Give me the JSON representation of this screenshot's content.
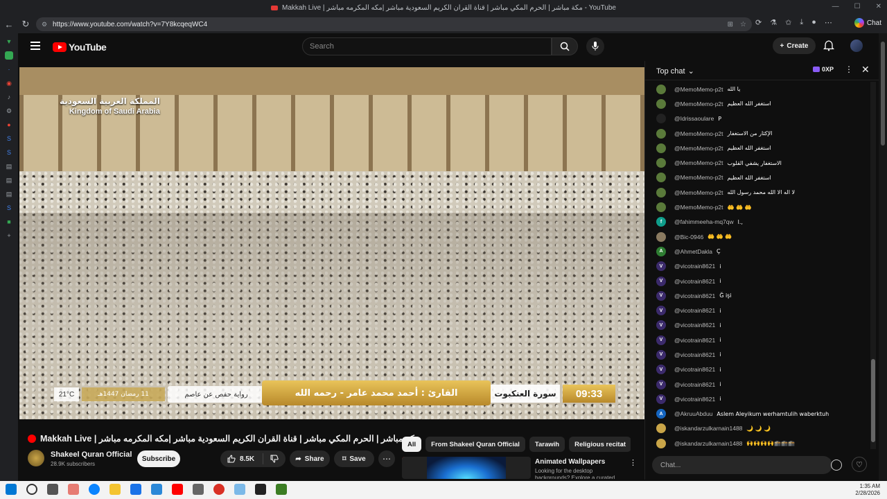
{
  "browser": {
    "tab_title": "Makkah Live | مكة مباشر | الحرم المكي مباشر | قناة القران الكريم السعودية مباشر |مكه المكرمه مباشر - YouTube",
    "url": "https://www.youtube.com/watch?v=7Y8kcqeqWC4",
    "chat_button": "Chat"
  },
  "youtube": {
    "logo_text": "YouTube",
    "search_placeholder": "Search",
    "create_label": "Create"
  },
  "video": {
    "overlay": {
      "country_ar": "المملكة العربية السعودية",
      "country_en": "Kingdom of Saudi Arabia",
      "reciter": "القارئ : أحمد محمد عامر - رحمه الله",
      "riwaya": "رواية حفص عن عاصم",
      "date": "11 رمضان 1447هـ",
      "temp": "21°C",
      "surah": "سورة العنكبوت",
      "time": "09:33"
    },
    "title": "Makkah Live | مكة مباشر | الحرم المكي مباشر | قناة القران الكريم السعودية مباشر |مكه المكرمه مباشر",
    "channel": "Shakeel Quran Official",
    "subscribers": "28.9K subscribers",
    "subscribe_label": "Subscribe",
    "likes": "8.5K",
    "share_label": "Share",
    "save_label": "Save"
  },
  "chips": [
    "All",
    "From Shakeel Quran Official",
    "Tarawih",
    "Religious recitat"
  ],
  "recommendation": {
    "title": "Animated Wallpapers",
    "desc": "Looking for the desktop backgrounds? Explore a curated"
  },
  "chat": {
    "header": "Top chat",
    "xp": "0XP",
    "input_placeholder": "Chat...",
    "messages": [
      {
        "author": "@MemoMemo-p2t",
        "text": "يا الله",
        "color": "#5a7a3a",
        "initial": ""
      },
      {
        "author": "@MemoMemo-p2t",
        "text": "استغفر الله العظيم",
        "color": "#5a7a3a",
        "initial": ""
      },
      {
        "author": "@Idrissaoulare",
        "text": "P",
        "color": "#222222",
        "initial": ""
      },
      {
        "author": "@MemoMemo-p2t",
        "text": "الإكثار من الاستغفار",
        "color": "#5a7a3a",
        "initial": ""
      },
      {
        "author": "@MemoMemo-p2t",
        "text": "استغفر الله العظيم",
        "color": "#5a7a3a",
        "initial": ""
      },
      {
        "author": "@MemoMemo-p2t",
        "text": "الاستغفار يشفي القلوب",
        "color": "#5a7a3a",
        "initial": ""
      },
      {
        "author": "@MemoMemo-p2t",
        "text": "استغفر الله العظيم",
        "color": "#5a7a3a",
        "initial": ""
      },
      {
        "author": "@MemoMemo-p2t",
        "text": "لا اله الا الله محمد رسول الله",
        "color": "#5a7a3a",
        "initial": ""
      },
      {
        "author": "@MemoMemo-p2t",
        "text": "🤲 🤲 🤲",
        "color": "#5a7a3a",
        "initial": ""
      },
      {
        "author": "@fahimmeeha-mq7qw",
        "text": "l.,",
        "color": "#0f9d8a",
        "initial": "f"
      },
      {
        "author": "@Bic-0946",
        "text": "🤲 🤲 🤲",
        "color": "#8a7a60",
        "initial": ""
      },
      {
        "author": "@AhmetDakla",
        "text": "Ç",
        "color": "#2e7d32",
        "initial": "A"
      },
      {
        "author": "@vicotrain8621",
        "text": "i",
        "color": "#3b2a6b",
        "initial": "V"
      },
      {
        "author": "@vicotrain8621",
        "text": "i",
        "color": "#3b2a6b",
        "initial": "V"
      },
      {
        "author": "@vicotrain8621",
        "text": "Ğ işi",
        "color": "#3b2a6b",
        "initial": "V"
      },
      {
        "author": "@vicotrain8621",
        "text": "i",
        "color": "#3b2a6b",
        "initial": "V"
      },
      {
        "author": "@vicotrain8621",
        "text": "i",
        "color": "#3b2a6b",
        "initial": "V"
      },
      {
        "author": "@vicotrain8621",
        "text": "i",
        "color": "#3b2a6b",
        "initial": "V"
      },
      {
        "author": "@vicotrain8621",
        "text": "i",
        "color": "#3b2a6b",
        "initial": "V"
      },
      {
        "author": "@vicotrain8621",
        "text": "i",
        "color": "#3b2a6b",
        "initial": "V"
      },
      {
        "author": "@vicotrain8621",
        "text": "i",
        "color": "#3b2a6b",
        "initial": "V"
      },
      {
        "author": "@vicotrain8621",
        "text": "i",
        "color": "#3b2a6b",
        "initial": "V"
      },
      {
        "author": "@AkruuAbduu",
        "text": "Aslem Aleyikum werhamtulih waberktuh",
        "color": "#1565c0",
        "initial": "A"
      },
      {
        "author": "@iskandarzulkarnain1488",
        "text": "🌙 🌙 🌙",
        "color": "#c9a548",
        "initial": ""
      },
      {
        "author": "@iskandarzulkarnain1488",
        "text": "🙌🙌🙌🙌🕋🕋🕋",
        "color": "#c9a548",
        "initial": ""
      }
    ]
  },
  "taskbar": {
    "time": "1:35 AM",
    "date": "2/28/2026"
  },
  "colors": {
    "youtube_red": "#ff0000",
    "background": "#0f0f0f",
    "gold": "#e9c45a"
  }
}
